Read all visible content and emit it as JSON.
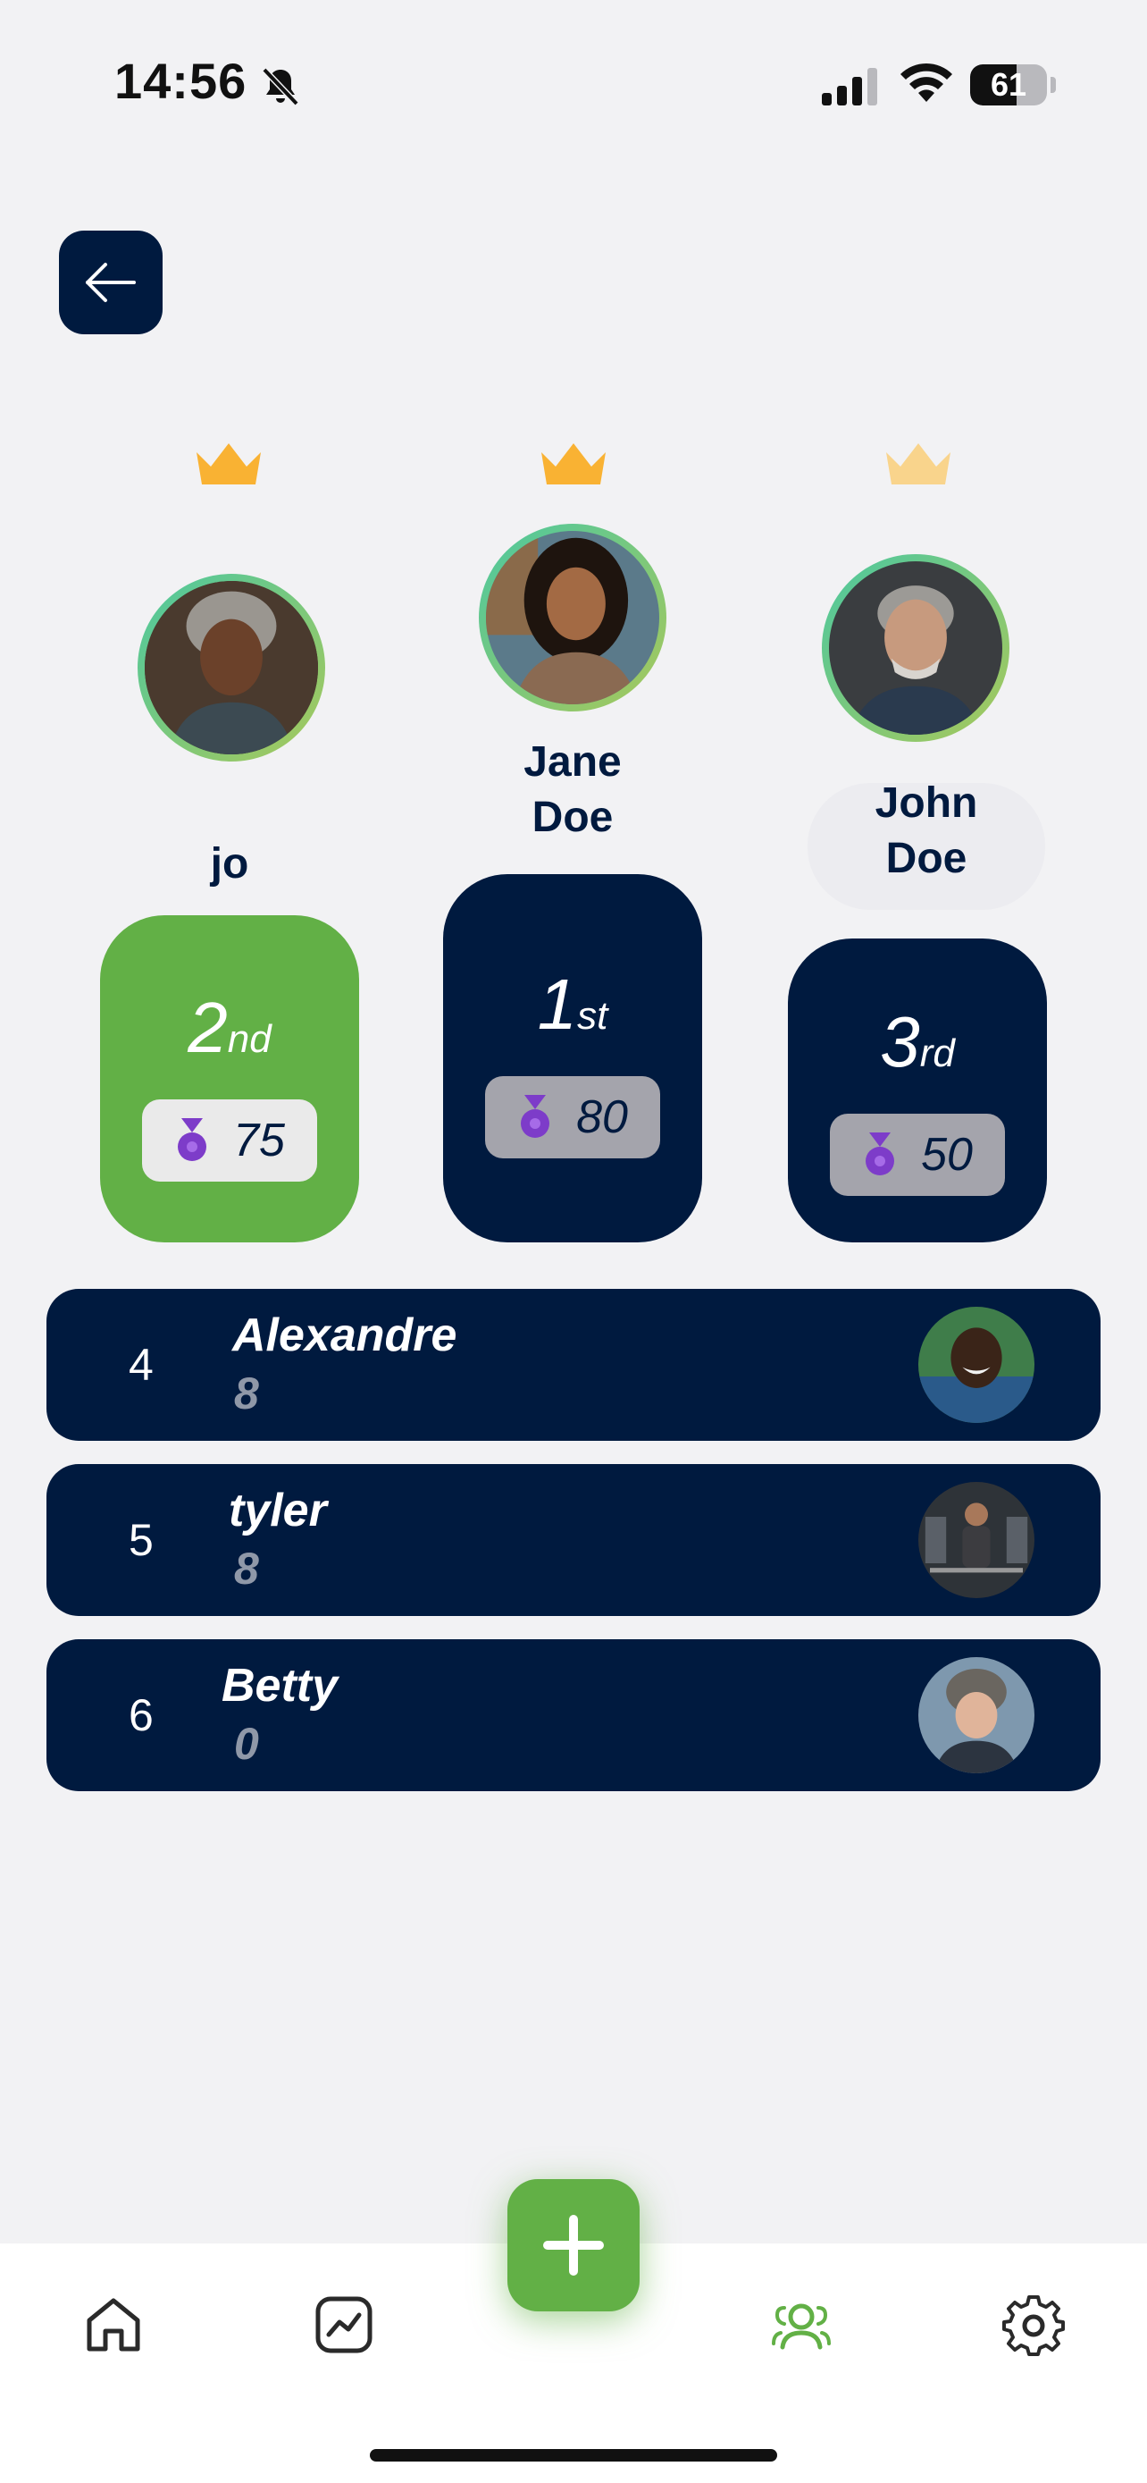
{
  "status_bar": {
    "time": "14:56",
    "battery": "61",
    "battery_level": 0.61
  },
  "podium": [
    {
      "place": "2",
      "suffix": "nd",
      "name": "jo",
      "score": "75",
      "block_color": "#62b046",
      "pill_color": "#eaeaea",
      "crown_color": "#f9b233"
    },
    {
      "place": "1",
      "suffix": "st",
      "name": "Jane\nDoe",
      "score": "80",
      "block_color": "#001a3f",
      "pill_color": "#a4a4ac",
      "crown_color": "#f9b233"
    },
    {
      "place": "3",
      "suffix": "rd",
      "name": "John\nDoe",
      "score": "50",
      "block_color": "#001a3f",
      "pill_color": "#a4a4ac",
      "crown_color": "#f9d48c"
    }
  ],
  "leaderboard": [
    {
      "rank": "4",
      "name": "Alexandre",
      "score": "8"
    },
    {
      "rank": "5",
      "name": "tyler",
      "score": "8"
    },
    {
      "rank": "6",
      "name": "Betty",
      "score": "0"
    }
  ],
  "nav": {
    "items": [
      "home-icon",
      "chart-icon",
      "add-icon",
      "users-icon",
      "gear-icon"
    ],
    "active": "users-icon",
    "active_color": "#62b046",
    "inactive_color": "#2a2a2a"
  },
  "colors": {
    "navy": "#001a3f",
    "green": "#62b046",
    "medal": "#7d3cc9"
  }
}
